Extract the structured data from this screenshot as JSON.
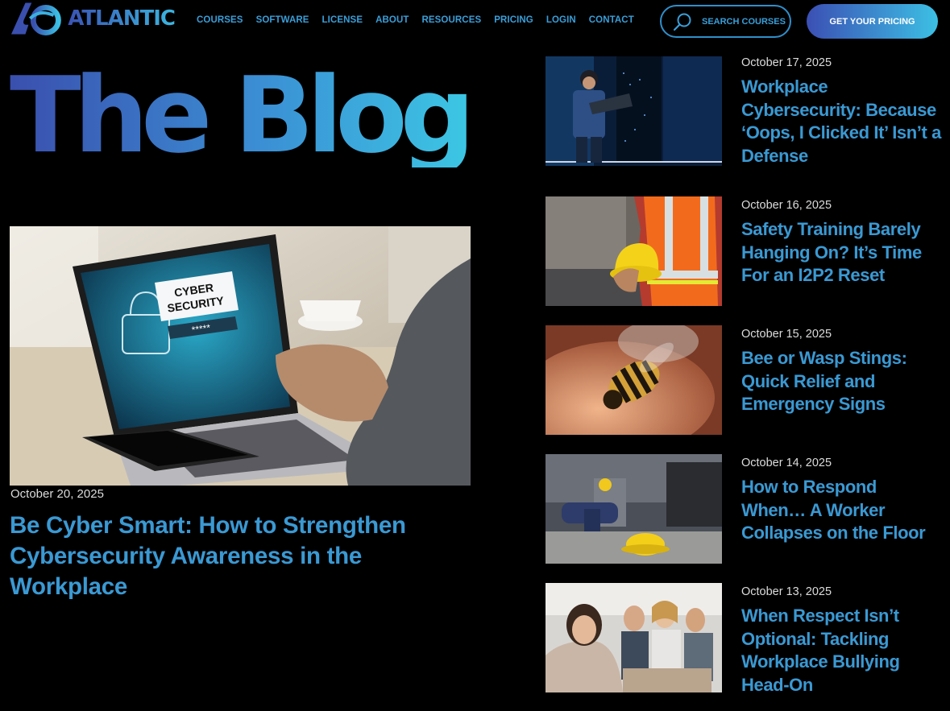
{
  "brand": {
    "name": "ATLANTIC"
  },
  "nav": {
    "items": [
      "COURSES",
      "SOFTWARE",
      "LICENSE",
      "ABOUT",
      "RESOURCES",
      "PRICING",
      "LOGIN",
      "CONTACT"
    ]
  },
  "search": {
    "label": "SEARCH COURSES",
    "icon": "search-icon"
  },
  "cta": {
    "label": "GET YOUR PRICING"
  },
  "colors": {
    "accent": "#3a99d3",
    "gradient_start": "#3a4fae",
    "gradient_end": "#3cc6e4",
    "background": "#000000"
  },
  "page": {
    "title": "The Blog"
  },
  "featured": {
    "date": "October 20, 2025",
    "title": "Be Cyber Smart: How to Strengthen Cybersecurity Awareness in the Workplace",
    "image_text": {
      "line1": "CYBER",
      "line2": "SECURITY",
      "password": "*****"
    }
  },
  "posts": [
    {
      "date": "October 17, 2025",
      "title": "Workplace Cybersecurity: Because ‘Oops, I Clicked It’ Isn’t a Defense"
    },
    {
      "date": "October 16, 2025",
      "title": "Safety Training Barely Hanging On? It’s Time For an I2P2 Reset"
    },
    {
      "date": "October 15, 2025",
      "title": "Bee or Wasp Stings: Quick Relief and Emergency Signs"
    },
    {
      "date": "October 14, 2025",
      "title": "How to Respond When… A Worker Collapses on the Floor"
    },
    {
      "date": "October 13, 2025",
      "title": "When Respect Isn’t Optional: Tackling Workplace Bullying Head-On"
    }
  ]
}
